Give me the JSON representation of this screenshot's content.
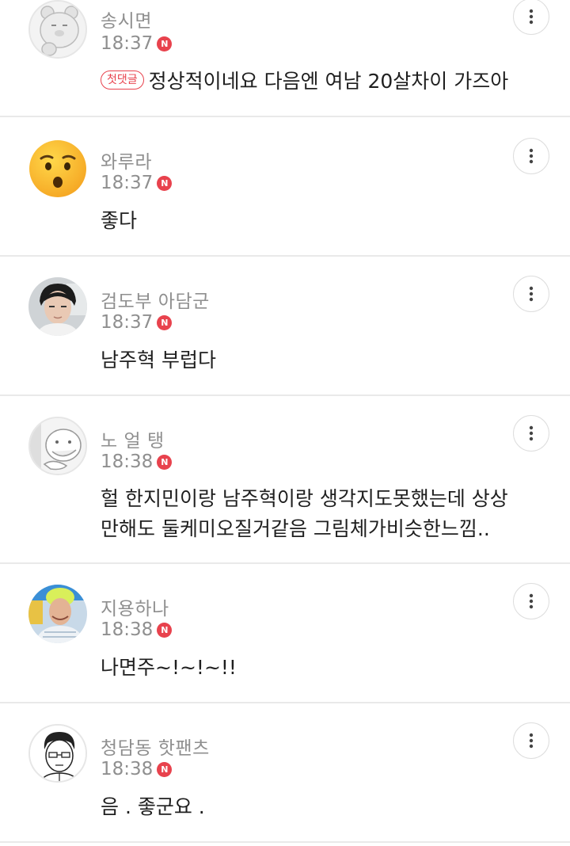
{
  "comments": [
    {
      "nickname": "송시면",
      "time": "18:37",
      "new_badge": "N",
      "first_comment_badge": "첫댓글",
      "text": "정상적이네요 다음엔 여남 20살차이 가즈아"
    },
    {
      "nickname": "와루라",
      "time": "18:37",
      "new_badge": "N",
      "text": "좋다"
    },
    {
      "nickname": "검도부 아담군",
      "time": "18:37",
      "new_badge": "N",
      "text": "남주혁 부럽다"
    },
    {
      "nickname": "노 얼 탱",
      "time": "18:38",
      "new_badge": "N",
      "text_line1": "헐 한지민이랑 남주혁이랑 생각지도못했는데 상상",
      "text_line2": "만해도 둘케미오질거같음 그림체가비슷한느낌.."
    },
    {
      "nickname": "지용하나",
      "time": "18:38",
      "new_badge": "N",
      "text": "나면주~!~!~!!"
    },
    {
      "nickname": "청담동 핫팬츠",
      "time": "18:38",
      "new_badge": "N",
      "text": "음 . 좋군요 ."
    }
  ],
  "colors": {
    "new_badge": "#e8424d",
    "meta_text": "#8f8f8f",
    "body_text": "#1f1f1f",
    "divider": "#e9e9e9"
  },
  "icons": {
    "more": "vertical-dots-icon"
  }
}
